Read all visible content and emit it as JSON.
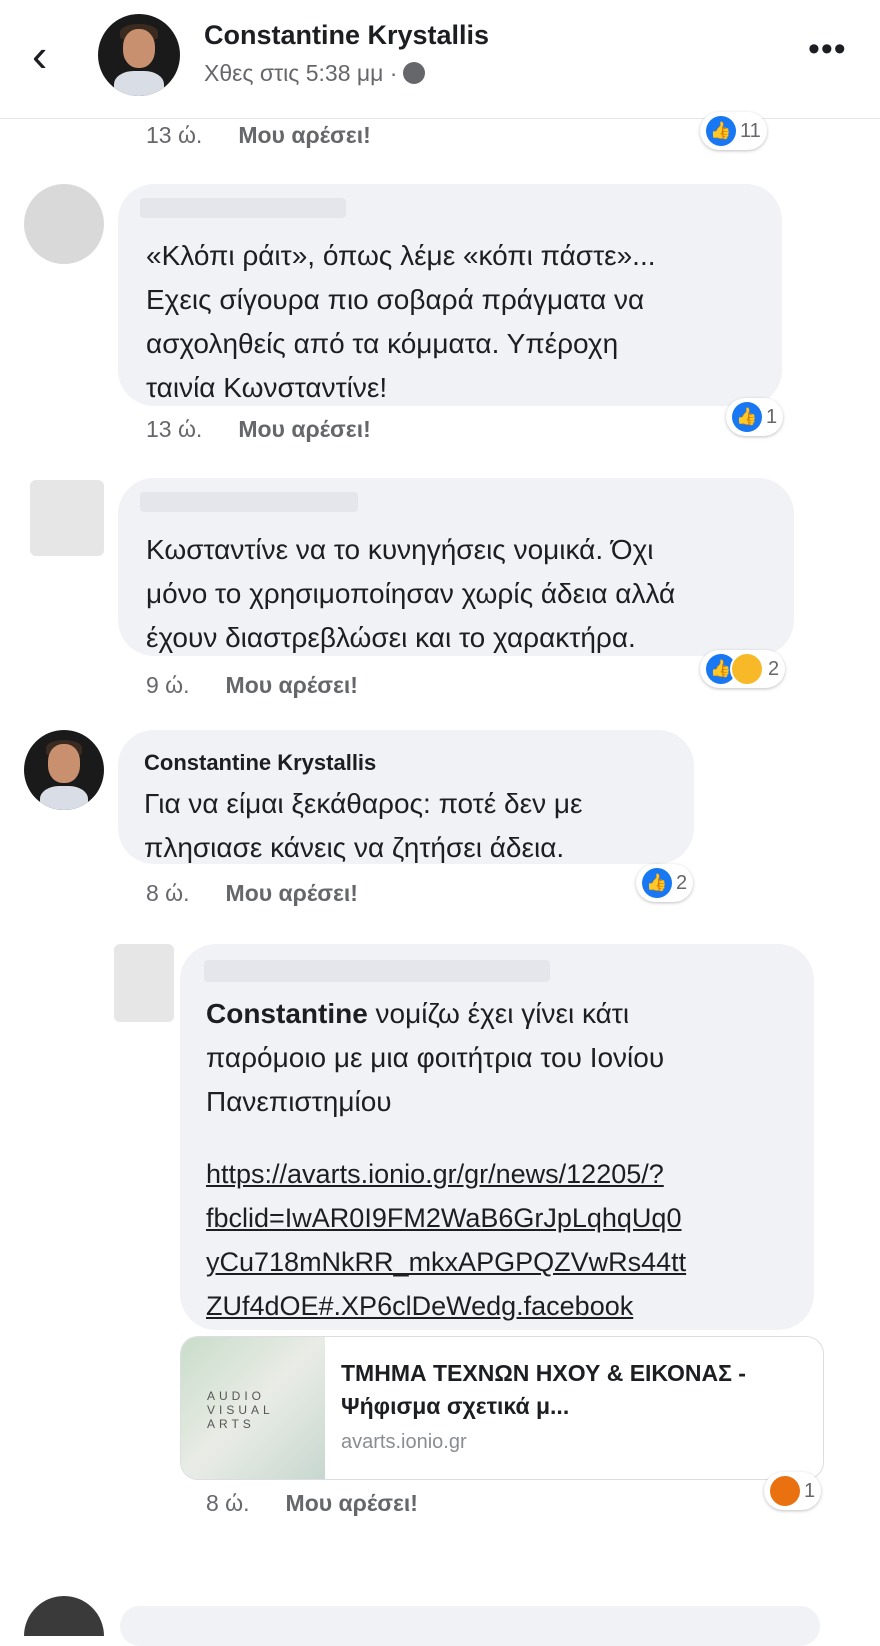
{
  "header": {
    "author": "Constantine Krystallis",
    "timestamp": "Χθες στις 5:38 μμ ·",
    "back_icon": "chevron-left-icon",
    "more_icon": "more-icon"
  },
  "top_meta": {
    "time": "13 ώ.",
    "like_label": "Μου αρέσει!",
    "reaction_count": "11"
  },
  "comments": [
    {
      "text": "«Κλόπι ράιτ», όπως λέμε «κόπι πάστε»...\nΕχεις σίγουρα πιο σοβαρά πράγματα να\nασχοληθείς από τα κόμματα. Υπέροχη\nταινία Κωνσταντίνε!",
      "time": "13 ώ.",
      "like_label": "Μου αρέσει!",
      "reaction_count": "1"
    },
    {
      "text": "Κωσταντίνε να το κυνηγήσεις νομικά. Όχι\nμόνο το χρησιμοποίησαν χωρίς άδεια αλλά\nέχουν διαστρεβλώσει και το χαρακτήρα.",
      "time": "9 ώ.",
      "like_label": "Μου αρέσει!",
      "reaction_count": "2"
    },
    {
      "author": "Constantine Krystallis",
      "text": "Για να είμαι ξεκάθαρος: ποτέ δεν με\nπλησιασε κάνεις να ζητήσει άδεια.",
      "time": "8 ώ.",
      "like_label": "Μου αρέσει!",
      "reaction_count": "2"
    }
  ],
  "reply": {
    "mention": "Constantine",
    "text": " νομίζω έχει γίνει κάτι\nπαρόμοιο με μια φοιτήτρια του Ιονίου\nΠανεπιστημίου",
    "link": "https://avarts.ionio.gr/gr/news/12205/?\nfbclid=IwAR0I9FM2WaB6GrJpLqhqUq0\nyCu718mNkRR_mkxAPGPQZVwRs44tt\nZUf4dOE#.XP6clDeWedg.facebook",
    "card_title": "ΤΜΗΜΑ ΤΕΧΝΩΝ ΗΧΟΥ & ΕΙΚΟΝΑΣ - Ψήφισμα σχετικά μ...",
    "card_domain": "avarts.ionio.gr",
    "card_logo": "AUDIO VISUAL ARTS",
    "time": "8 ώ.",
    "like_label": "Μου αρέσει!",
    "reaction_count": "1"
  },
  "colors": {
    "like": "#1877f2",
    "bubble": "#f0f2f5",
    "meta": "#65676b"
  }
}
